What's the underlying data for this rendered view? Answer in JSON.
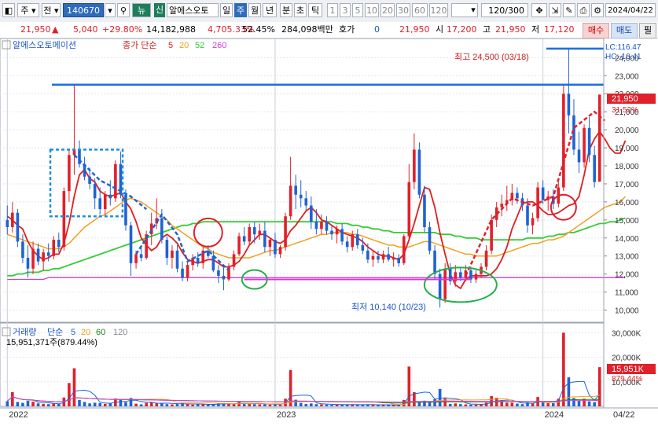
{
  "toolbar": {
    "market": "주",
    "period_select": "전",
    "code": "140670",
    "news_label": "뉴",
    "credit_badge": "신",
    "stock_name": "알에스오토",
    "tabs": [
      "일",
      "주",
      "월",
      "년",
      "분",
      "초",
      "틱"
    ],
    "active_tab": "주",
    "numbers": [
      "1",
      "3",
      "5",
      "10",
      "20",
      "30",
      "60",
      "120"
    ],
    "count": "120/300",
    "date": "2024/04/22"
  },
  "info": {
    "price": "21,950",
    "change": "5,040",
    "change_pct": "+29.80%",
    "volume": "14,182,988",
    "vol_ratio": "4,705.33%",
    "turnover": "52.45%",
    "amount": "284,098백만",
    "hoga_label": "호가",
    "hoga_val": "0",
    "hoga_price": "21,950",
    "open_label": "시",
    "open": "17,200",
    "high_label": "고",
    "high": "21,950",
    "low_label": "저",
    "low": "17,120",
    "buy": "매수",
    "sell": "매도",
    "close_btn": "필"
  },
  "colors": {
    "up": "#e0202a",
    "down": "#1f63d3",
    "ma5": "#e01e1e",
    "ma20": "#f0a020",
    "ma60": "#33cc33",
    "ma120": "#d23cd2"
  },
  "chart_data": {
    "type": "candlestick",
    "price_legend": {
      "name": "알에스오토메이션",
      "label": "종가 단순",
      "periods": [
        "5",
        "20",
        "52",
        "260"
      ]
    },
    "volume_legend": {
      "name": "거래량",
      "label": "단순",
      "periods": [
        "5",
        "20",
        "60",
        "120"
      ],
      "value": "15,951,371주(879.44%)"
    },
    "y_ticks": [
      "10,000",
      "11,000",
      "12,000",
      "13,000",
      "14,000",
      "15,000",
      "16,000",
      "17,000",
      "18,000",
      "19,000",
      "20,000",
      "21,000",
      "22,000",
      "23,000",
      "24,000"
    ],
    "ylim": [
      9500,
      24800
    ],
    "vol_ticks": [
      "10,000K",
      "20,000K",
      "30,000K"
    ],
    "vol_ylim": [
      0,
      32000
    ],
    "x_labels": [
      {
        "i": 0,
        "text": "2022"
      },
      {
        "i": 52,
        "text": "2023"
      },
      {
        "i": 104,
        "text": "2024"
      },
      {
        "i": 123,
        "text": "04/22"
      }
    ],
    "annotations": {
      "high": "최고 24,500 (03/18)",
      "low": "최저 10,140 (10/23)",
      "lc": "LC:116.47",
      "hc": "HC:-10.41",
      "last_price": "21,950",
      "last_pct": "31.52%",
      "last_vol": "15,951K",
      "last_vol_pct": "879.44%"
    },
    "candles": [
      [
        15000,
        15800,
        14200,
        14600
      ],
      [
        14600,
        16000,
        14300,
        15400
      ],
      [
        15400,
        15600,
        13500,
        13800
      ],
      [
        13800,
        14200,
        12600,
        12900
      ],
      [
        12900,
        13600,
        11800,
        12300
      ],
      [
        12300,
        13800,
        12000,
        13400
      ],
      [
        13400,
        13700,
        12500,
        12700
      ],
      [
        12700,
        13400,
        12200,
        13200
      ],
      [
        13200,
        13700,
        12700,
        13000
      ],
      [
        13000,
        14100,
        12800,
        13900
      ],
      [
        13900,
        14300,
        13200,
        13500
      ],
      [
        13500,
        16800,
        13300,
        16600
      ],
      [
        16600,
        18900,
        16000,
        18600
      ],
      [
        18600,
        22500,
        17500,
        18900
      ],
      [
        18900,
        19400,
        17900,
        18100
      ],
      [
        18100,
        18500,
        17200,
        17400
      ],
      [
        17400,
        17900,
        16700,
        17000
      ],
      [
        17000,
        17300,
        15600,
        16200
      ],
      [
        16200,
        16800,
        15300,
        15600
      ],
      [
        15600,
        16600,
        15200,
        16400
      ],
      [
        16400,
        17200,
        15800,
        16200
      ],
      [
        16200,
        18300,
        16000,
        18100
      ],
      [
        18100,
        18800,
        16200,
        16400
      ],
      [
        16400,
        16700,
        14400,
        14700
      ],
      [
        14700,
        14900,
        11900,
        12600
      ],
      [
        12600,
        13300,
        12300,
        13100
      ],
      [
        13100,
        13500,
        12700,
        12900
      ],
      [
        12900,
        14400,
        12800,
        14200
      ],
      [
        14200,
        15400,
        13600,
        14800
      ],
      [
        14800,
        16200,
        14500,
        15100
      ],
      [
        15100,
        15600,
        13700,
        13900
      ],
      [
        13900,
        14100,
        12500,
        12900
      ],
      [
        12900,
        13600,
        12300,
        13300
      ],
      [
        13300,
        13600,
        12100,
        12300
      ],
      [
        12300,
        12700,
        11600,
        11800
      ],
      [
        11800,
        12700,
        11600,
        12500
      ],
      [
        12500,
        13100,
        12200,
        12900
      ],
      [
        12900,
        13200,
        12400,
        12600
      ],
      [
        12600,
        13500,
        12300,
        13300
      ],
      [
        13300,
        13600,
        12900,
        13000
      ],
      [
        13000,
        13300,
        12100,
        12200
      ],
      [
        12200,
        12500,
        11500,
        11900
      ],
      [
        11900,
        12400,
        11100,
        11700
      ],
      [
        11700,
        12600,
        11600,
        12400
      ],
      [
        12400,
        13300,
        12200,
        13100
      ],
      [
        13100,
        14300,
        13000,
        14100
      ],
      [
        14100,
        14600,
        13600,
        13800
      ],
      [
        13800,
        14800,
        13600,
        14600
      ],
      [
        14600,
        14900,
        13700,
        14200
      ],
      [
        14200,
        14800,
        13900,
        14400
      ],
      [
        14400,
        14900,
        13200,
        13500
      ],
      [
        13500,
        14000,
        13000,
        13900
      ],
      [
        13900,
        14300,
        12900,
        13100
      ],
      [
        13100,
        13600,
        12900,
        13500
      ],
      [
        13500,
        15400,
        13300,
        15200
      ],
      [
        15200,
        18500,
        15000,
        16900
      ],
      [
        16900,
        17500,
        15600,
        16400
      ],
      [
        16400,
        17200,
        15700,
        16200
      ],
      [
        16200,
        16600,
        15500,
        15800
      ],
      [
        15800,
        16300,
        14500,
        14900
      ],
      [
        14900,
        15600,
        14200,
        14500
      ],
      [
        14500,
        15300,
        14200,
        14900
      ],
      [
        14900,
        15200,
        14200,
        14400
      ],
      [
        14400,
        14700,
        13900,
        14200
      ],
      [
        14200,
        14700,
        13700,
        14500
      ],
      [
        14500,
        14800,
        13600,
        13800
      ],
      [
        13800,
        14100,
        13200,
        13500
      ],
      [
        13500,
        14400,
        13300,
        14200
      ],
      [
        14200,
        14500,
        13400,
        13600
      ],
      [
        13600,
        14000,
        13100,
        13300
      ],
      [
        13300,
        13700,
        12600,
        12800
      ],
      [
        12800,
        13300,
        12400,
        13000
      ],
      [
        13000,
        13300,
        12600,
        12800
      ],
      [
        12800,
        13300,
        12600,
        13100
      ],
      [
        13100,
        13500,
        12700,
        12800
      ],
      [
        12800,
        13200,
        12400,
        12900
      ],
      [
        12900,
        13100,
        12400,
        12600
      ],
      [
        12600,
        14200,
        12500,
        14100
      ],
      [
        14100,
        18100,
        13900,
        17100
      ],
      [
        17100,
        19800,
        16700,
        18900
      ],
      [
        18900,
        19300,
        16200,
        16400
      ],
      [
        16400,
        16900,
        14300,
        14600
      ],
      [
        14600,
        14900,
        13100,
        13300
      ],
      [
        13300,
        13600,
        11700,
        12000
      ],
      [
        12000,
        12300,
        10140,
        10600
      ],
      [
        10600,
        12600,
        10400,
        12300
      ],
      [
        12300,
        12600,
        11400,
        11600
      ],
      [
        11600,
        12500,
        11300,
        12100
      ],
      [
        12100,
        12400,
        11600,
        11800
      ],
      [
        11800,
        12500,
        11600,
        12200
      ],
      [
        12200,
        12400,
        11500,
        11700
      ],
      [
        11700,
        12200,
        11500,
        12000
      ],
      [
        12000,
        12600,
        11800,
        12400
      ],
      [
        12400,
        13600,
        12200,
        13300
      ],
      [
        13300,
        15300,
        13100,
        15000
      ],
      [
        15000,
        16000,
        14600,
        15700
      ],
      [
        15700,
        16400,
        15200,
        15900
      ],
      [
        15900,
        16900,
        15500,
        16100
      ],
      [
        16100,
        17000,
        15800,
        16500
      ],
      [
        16500,
        16800,
        15900,
        16200
      ],
      [
        16200,
        16500,
        15500,
        15800
      ],
      [
        15800,
        16200,
        14300,
        14700
      ],
      [
        14700,
        15400,
        14200,
        15100
      ],
      [
        15100,
        17100,
        14900,
        16800
      ],
      [
        16800,
        17200,
        15900,
        16100
      ],
      [
        16100,
        16600,
        15500,
        16300
      ],
      [
        16300,
        16700,
        15600,
        15900
      ],
      [
        15900,
        17100,
        15700,
        16800
      ],
      [
        16800,
        22500,
        16600,
        22000
      ],
      [
        22000,
        24500,
        19800,
        20800
      ],
      [
        20800,
        21700,
        18600,
        18900
      ],
      [
        18900,
        19900,
        17600,
        18200
      ],
      [
        18200,
        20300,
        17900,
        20100
      ],
      [
        20100,
        20700,
        18200,
        18600
      ],
      [
        18600,
        19100,
        16800,
        17100
      ],
      [
        17120,
        21950,
        17120,
        21950
      ]
    ],
    "volumes": [
      2100,
      5800,
      1800,
      1400,
      2200,
      1900,
      1200,
      1000,
      900,
      1100,
      1000,
      3600,
      9500,
      15500,
      2600,
      1800,
      1200,
      1500,
      1300,
      1000,
      1200,
      3200,
      2900,
      1700,
      3400,
      1100,
      800,
      1400,
      1600,
      1400,
      1200,
      900,
      800,
      1100,
      1300,
      900,
      700,
      800,
      900,
      700,
      900,
      1100,
      1400,
      900,
      1000,
      1800,
      1100,
      1300,
      900,
      800,
      1000,
      700,
      900,
      600,
      3100,
      14800,
      2700,
      1400,
      1000,
      1200,
      900,
      800,
      700,
      600,
      800,
      700,
      700,
      800,
      600,
      600,
      800,
      700,
      500,
      600,
      600,
      500,
      600,
      2600,
      16200,
      5800,
      2000,
      2300,
      1900,
      2900,
      7100,
      3200,
      1000,
      1200,
      900,
      800,
      700,
      700,
      900,
      1500,
      4200,
      3500,
      1900,
      1500,
      1500,
      1100,
      900,
      1600,
      1200,
      3800,
      2000,
      1300,
      1300,
      3100,
      30000,
      11800,
      3400,
      2200,
      3100,
      2000,
      1700,
      15951
    ],
    "ma5": [
      15200,
      15000,
      14700,
      14500,
      13800,
      13300,
      13000,
      12800,
      12900,
      13100,
      13100,
      13700,
      14800,
      16300,
      17500,
      17800,
      17300,
      17100,
      16600,
      16400,
      16300,
      16400,
      16500,
      16000,
      15600,
      14900,
      14000,
      13600,
      13300,
      13500,
      14000,
      14200,
      14000,
      13700,
      13200,
      12800,
      12700,
      12600,
      12700,
      12800,
      12800,
      12600,
      12400,
      12400,
      12500,
      12700,
      13100,
      13600,
      13900,
      14200,
      14200,
      14000,
      13800,
      13700,
      13900,
      14400,
      14700,
      15100,
      15500,
      15700,
      15400,
      15000,
      14900,
      14700,
      14500,
      14300,
      14200,
      14100,
      14000,
      13800,
      13500,
      13300,
      13100,
      13000,
      13000,
      12900,
      12800,
      13100,
      13900,
      14800,
      15800,
      16800,
      16700,
      15700,
      14300,
      13100,
      12000,
      11400,
      11200,
      11700,
      11900,
      11900,
      11900,
      11900,
      12000,
      12300,
      12800,
      13500,
      14500,
      15200,
      15900,
      16000,
      16000,
      15800,
      15500,
      15300,
      15300,
      15400,
      15600,
      15800,
      15900,
      16300,
      17500,
      18900,
      19500,
      19900,
      19500,
      19000,
      18700,
      18700,
      19400
    ],
    "ma20": [
      14200,
      14100,
      14000,
      13900,
      13800,
      13700,
      13600,
      13500,
      13400,
      13400,
      13400,
      13500,
      13700,
      14000,
      14300,
      14600,
      14800,
      15000,
      15200,
      15300,
      15500,
      15700,
      15900,
      16100,
      16200,
      16100,
      16000,
      15800,
      15600,
      15400,
      15200,
      15000,
      14700,
      14500,
      14300,
      14100,
      13900,
      13700,
      13500,
      13400,
      13200,
      13100,
      13000,
      12900,
      12900,
      12900,
      12900,
      12900,
      13000,
      13100,
      13200,
      13300,
      13300,
      13400,
      13500,
      13600,
      13700,
      13800,
      13900,
      14000,
      14100,
      14200,
      14200,
      14300,
      14300,
      14300,
      14300,
      14200,
      14200,
      14100,
      14000,
      13900,
      13800,
      13700,
      13600,
      13600,
      13500,
      13500,
      13500,
      13600,
      13700,
      13800,
      13800,
      13700,
      13600,
      13500,
      13400,
      13300,
      13200,
      13100,
      13100,
      13000,
      13000,
      13000,
      13000,
      13000,
      13100,
      13200,
      13300,
      13400,
      13500,
      13600,
      13700,
      13700,
      13800,
      13900,
      13900,
      14000,
      14100,
      14300,
      14500,
      14700,
      14900,
      15100,
      15300,
      15500,
      15700,
      15800,
      15900,
      16000,
      16300
    ],
    "ma60": [
      11900,
      11900,
      12000,
      12000,
      12100,
      12100,
      12100,
      12200,
      12200,
      12300,
      12300,
      12400,
      12500,
      12600,
      12700,
      12800,
      12900,
      13000,
      13100,
      13200,
      13300,
      13400,
      13500,
      13600,
      13700,
      13800,
      13900,
      14000,
      14100,
      14200,
      14300,
      14400,
      14500,
      14600,
      14700,
      14700,
      14800,
      14800,
      14900,
      14900,
      14900,
      14900,
      14900,
      14900,
      14900,
      14900,
      14900,
      14900,
      14900,
      14900,
      14900,
      14900,
      14900,
      14900,
      14900,
      14900,
      14900,
      14900,
      14900,
      14900,
      14900,
      14900,
      14900,
      14900,
      14800,
      14800,
      14800,
      14700,
      14700,
      14600,
      14600,
      14500,
      14500,
      14400,
      14400,
      14300,
      14300,
      14300,
      14300,
      14300,
      14300,
      14300,
      14300,
      14300,
      14200,
      14200,
      14200,
      14100,
      14100,
      14000,
      14000,
      14000,
      13900,
      13900,
      13900,
      13900,
      13900,
      13900,
      13900,
      13900,
      13900,
      14000,
      14000,
      14000,
      14000,
      14100,
      14100,
      14200,
      14200,
      14300,
      14300,
      14400,
      14500,
      14600,
      14700,
      14800,
      14800,
      14900,
      14900,
      15000,
      15100
    ],
    "ma120": [
      11700,
      11700,
      11700,
      11700,
      11700,
      11700,
      11700,
      11700,
      11800,
      11800,
      11800,
      11800,
      11800,
      11800,
      11800,
      11800,
      11800,
      11800,
      11800,
      11800,
      11800,
      11800,
      11800,
      11800,
      11800,
      11800,
      11800,
      11800,
      11800,
      11800,
      11800,
      11800,
      11800,
      11800,
      11800,
      11800,
      11800,
      11800,
      11800,
      11800,
      11800,
      11800,
      11800,
      11800,
      11800,
      11800,
      11800,
      11800,
      11800,
      11800,
      11800,
      11800,
      11800,
      11800,
      11800,
      11800,
      11800,
      11800,
      11800,
      11800,
      11800,
      11800,
      11800,
      11800,
      11800,
      11800,
      11800,
      11800,
      11800,
      11800,
      11800,
      11800,
      11800,
      11800,
      11800,
      11800,
      11800,
      11800,
      11800,
      11800,
      11800,
      11800,
      11800,
      11800,
      11800,
      11800,
      11800,
      11800,
      11800,
      11800,
      11800,
      11800,
      11800,
      11800,
      11800,
      11800,
      11800,
      11800,
      11800,
      11800,
      11800,
      11800,
      11800,
      11800,
      11800,
      11800,
      11800,
      11800,
      11800,
      11800,
      11800,
      11800,
      11800,
      11800,
      11800,
      11800,
      11800,
      11800,
      11800,
      11800,
      11800
    ]
  }
}
